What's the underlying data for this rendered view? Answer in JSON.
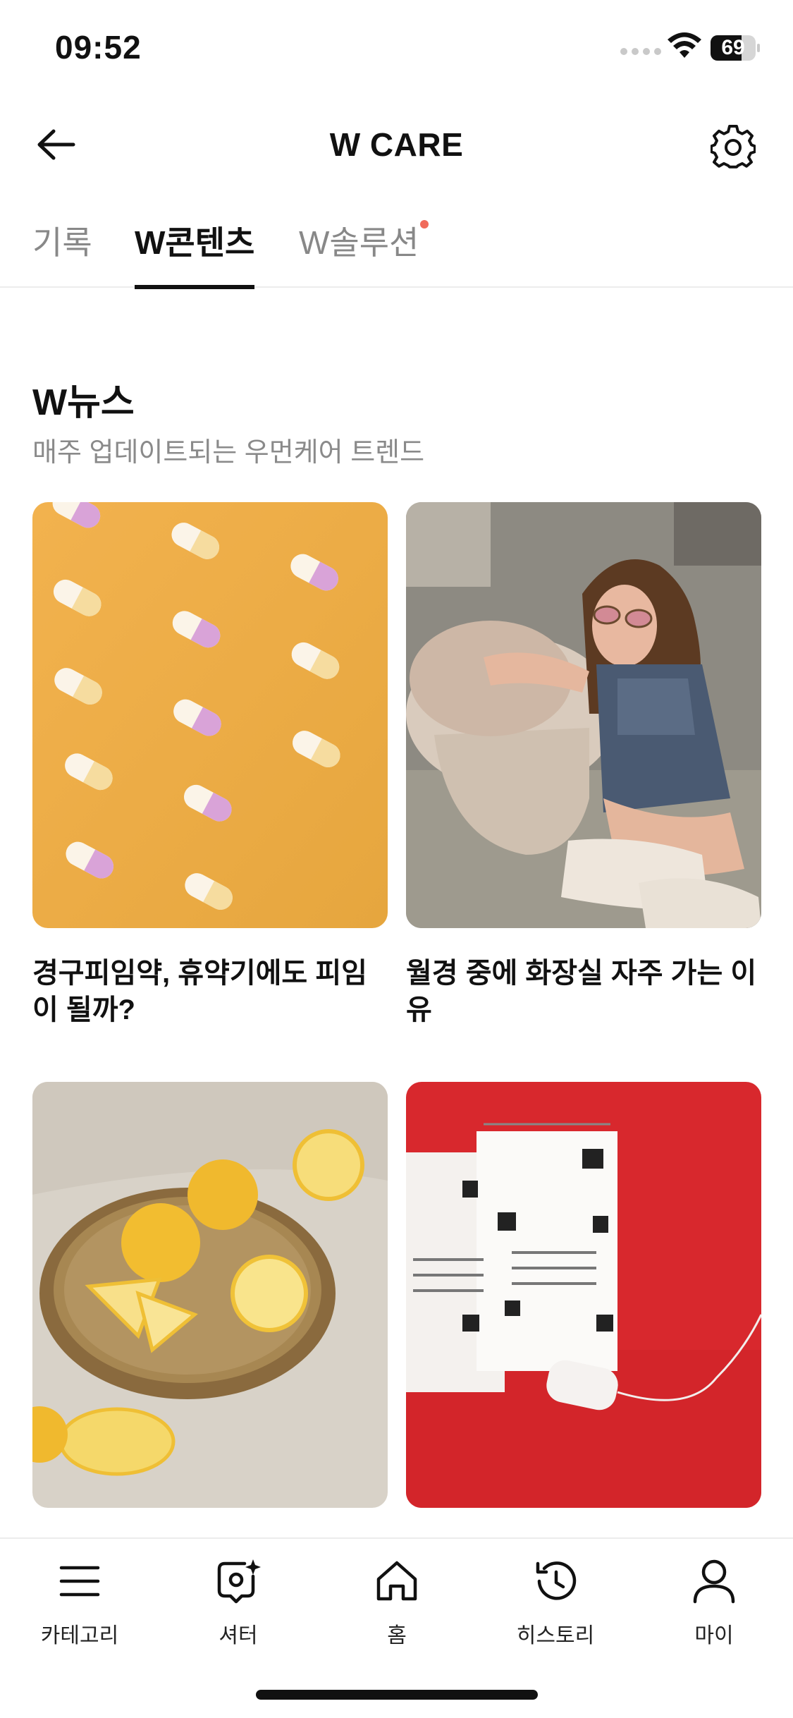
{
  "status_bar": {
    "time": "09:52",
    "battery_level": "69",
    "battery_percent": 69
  },
  "header": {
    "title": "W CARE",
    "back_icon": "arrow-left-icon",
    "settings_icon": "gear-icon"
  },
  "tabs": [
    {
      "label": "기록",
      "active": false,
      "has_badge": false
    },
    {
      "label": "W콘텐츠",
      "active": true,
      "has_badge": false
    },
    {
      "label": "W솔루션",
      "active": false,
      "has_badge": true
    }
  ],
  "section": {
    "title": "W뉴스",
    "subtitle": "매주 업데이트되는 우먼케어 트렌드"
  },
  "cards": [
    {
      "title": "경구피임약, 휴약기에도 피임이 될까?",
      "image": "pills-photo"
    },
    {
      "title": "월경 중에 화장실 자주 가는 이유",
      "image": "woman-toilet-photo"
    },
    {
      "title": "",
      "image": "lemons-photo"
    },
    {
      "title": "",
      "image": "calendar-tampon-photo"
    }
  ],
  "bottom_nav": [
    {
      "label": "카테고리",
      "icon": "menu-icon"
    },
    {
      "label": "셔터",
      "icon": "camera-sparkle-icon"
    },
    {
      "label": "홈",
      "icon": "home-icon"
    },
    {
      "label": "히스토리",
      "icon": "history-icon"
    },
    {
      "label": "마이",
      "icon": "user-icon"
    }
  ],
  "colors": {
    "text_primary": "#111111",
    "text_secondary": "#8a8a8a",
    "badge": "#f06a5a"
  }
}
